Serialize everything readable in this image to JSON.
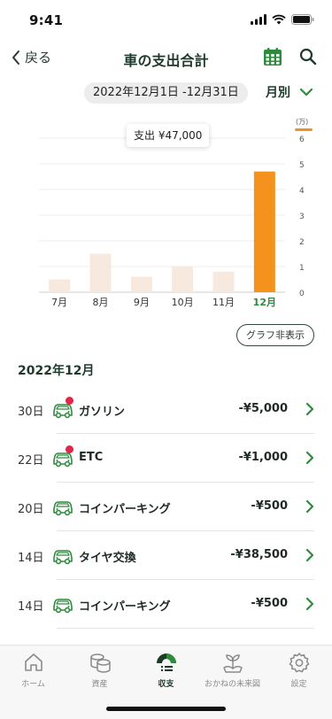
{
  "status_bar": {
    "time": "9:41"
  },
  "nav": {
    "back_label": "戻る",
    "title": "車の支出合計"
  },
  "period": {
    "range": "2022年12月1日 -12月31日",
    "mode": "月別"
  },
  "colors": {
    "accent": "#2e8b3e",
    "bar_highlight": "#f5921e",
    "bar_normal": "#f8e9df",
    "text_dark": "#1e3a2b"
  },
  "chart_data": {
    "type": "bar",
    "categories": [
      "7月",
      "8月",
      "9月",
      "10月",
      "11月",
      "12月"
    ],
    "values": [
      0.5,
      1.5,
      0.6,
      1.0,
      0.8,
      4.7
    ],
    "selected_index": 5,
    "unit_label": "(万)",
    "ylim": [
      0,
      6
    ],
    "yticks": [
      "0",
      "1",
      "2",
      "3",
      "4",
      "5",
      "6"
    ],
    "tooltip": "支出 ¥47,000",
    "grid": true
  },
  "graph_toggle_label": "グラフ非表示",
  "month_heading": "2022年12月",
  "transactions": [
    {
      "day": "30日",
      "name": "ガソリン",
      "amount": "-¥5,000",
      "icon": "car-icon",
      "unread": true
    },
    {
      "day": "22日",
      "name": "ETC",
      "amount": "-¥1,000",
      "icon": "car-icon",
      "unread": true
    },
    {
      "day": "20日",
      "name": "コインパーキング",
      "amount": "-¥500",
      "icon": "car-icon",
      "unread": false
    },
    {
      "day": "14日",
      "name": "タイヤ交換",
      "amount": "-¥38,500",
      "icon": "car-icon",
      "unread": false
    },
    {
      "day": "14日",
      "name": "コインパーキング",
      "amount": "-¥500",
      "icon": "car-icon",
      "unread": false
    }
  ],
  "tabs": [
    {
      "label": "ホーム",
      "icon": "home-icon",
      "active": false
    },
    {
      "label": "資産",
      "icon": "coins-icon",
      "active": false
    },
    {
      "label": "収支",
      "icon": "cashflow-icon",
      "active": true
    },
    {
      "label": "おかねの未来図",
      "icon": "sprout-icon",
      "active": false
    },
    {
      "label": "設定",
      "icon": "gear-icon",
      "active": false
    }
  ]
}
